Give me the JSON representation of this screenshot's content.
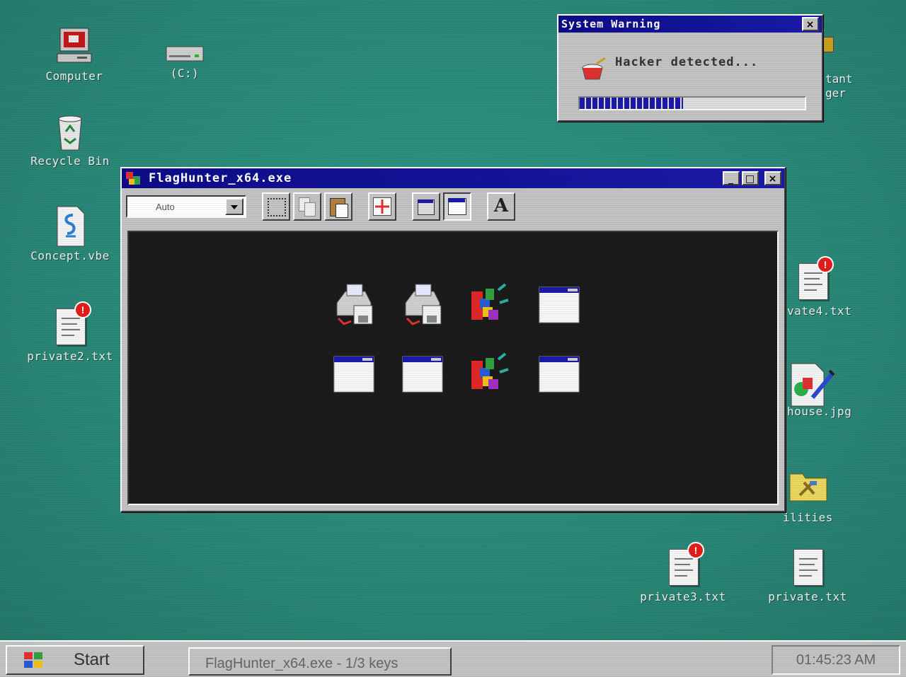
{
  "desktop": {
    "icons": {
      "computer": "Computer",
      "drive_c": "(C:)",
      "recycle_bin": "Recycle Bin",
      "concept": "Concept.vbe",
      "private2": "private2.txt",
      "assistant_partial": "tant",
      "assistant_partial2": "ger",
      "private4": "vate4.txt",
      "house": "house.jpg",
      "utilities": "ilities",
      "private3": "private3.txt",
      "private": "private.txt"
    }
  },
  "warning_dialog": {
    "title": "System Warning",
    "message": "Hacker detected...",
    "close_label": "×",
    "progress": 0.46
  },
  "main_window": {
    "title": "FlagHunter_x64.exe",
    "minimize_label": "_",
    "maximize_label": "□",
    "close_label": "×",
    "combo_value": "Auto",
    "font_button_label": "A",
    "canvas_icons": [
      "printer-disk-icon",
      "printer-disk-icon",
      "blocks-icon",
      "window-icon",
      "window-icon",
      "window-icon",
      "blocks-icon",
      "window-icon"
    ]
  },
  "taskbar": {
    "start_label": "Start",
    "task_item": "FlagHunter_x64.exe - 1/3 keys",
    "clock": "01:45:23 AM"
  }
}
